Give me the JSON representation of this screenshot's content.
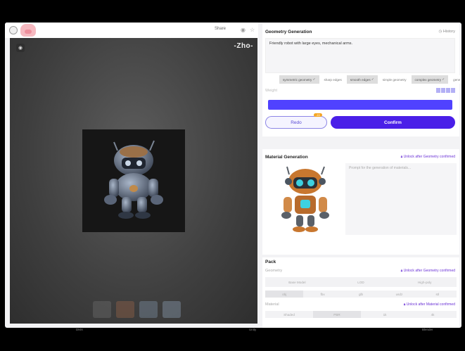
{
  "topbar": {
    "share_label": "Share",
    "icons": [
      "user-avatar",
      "pig-logo",
      "share-icon",
      "eye-icon",
      "star-icon"
    ]
  },
  "viewer": {
    "watermark": "-Zho-",
    "background_color": "#4a4a4a"
  },
  "geometry": {
    "title": "Geometry Generation",
    "history_label": "History",
    "prompt": "Friendly robot with large eyes, mechanical arms.",
    "chips": [
      {
        "label": "symmetric geometry",
        "selected": true
      },
      {
        "label": "sharp edges",
        "selected": false
      },
      {
        "label": "smooth edges",
        "selected": true
      },
      {
        "label": "simple geometry",
        "selected": false
      },
      {
        "label": "complex geometry",
        "selected": true
      },
      {
        "label": "gene",
        "selected": false
      }
    ],
    "weight_label": "Weight",
    "redo_label": "Redo",
    "redo_badge": "-15",
    "confirm_label": "Confirm",
    "accent_color": "#4a1fe8"
  },
  "material": {
    "title": "Material Generation",
    "unlock_label": "Unlock after Geometry confirmed",
    "placeholder": "Prompt for the generation of materials..."
  },
  "pack": {
    "title": "Pack",
    "geometry_label": "Geometry",
    "geometry_unlock": "Unlock after Geometry confirmed",
    "model_options": [
      "Base Model",
      "LOD",
      "High-poly"
    ],
    "format_options": [
      "obj",
      "fbx",
      "glb",
      "usdz",
      "stl"
    ],
    "material_label": "Material",
    "material_unlock": "Unlock after Material confirmed",
    "material_options": [
      "Shaded",
      "PBR",
      "1k",
      "4k"
    ]
  },
  "bottom": {
    "labels": [
      "DMX",
      "Unity",
      "Blender"
    ]
  }
}
